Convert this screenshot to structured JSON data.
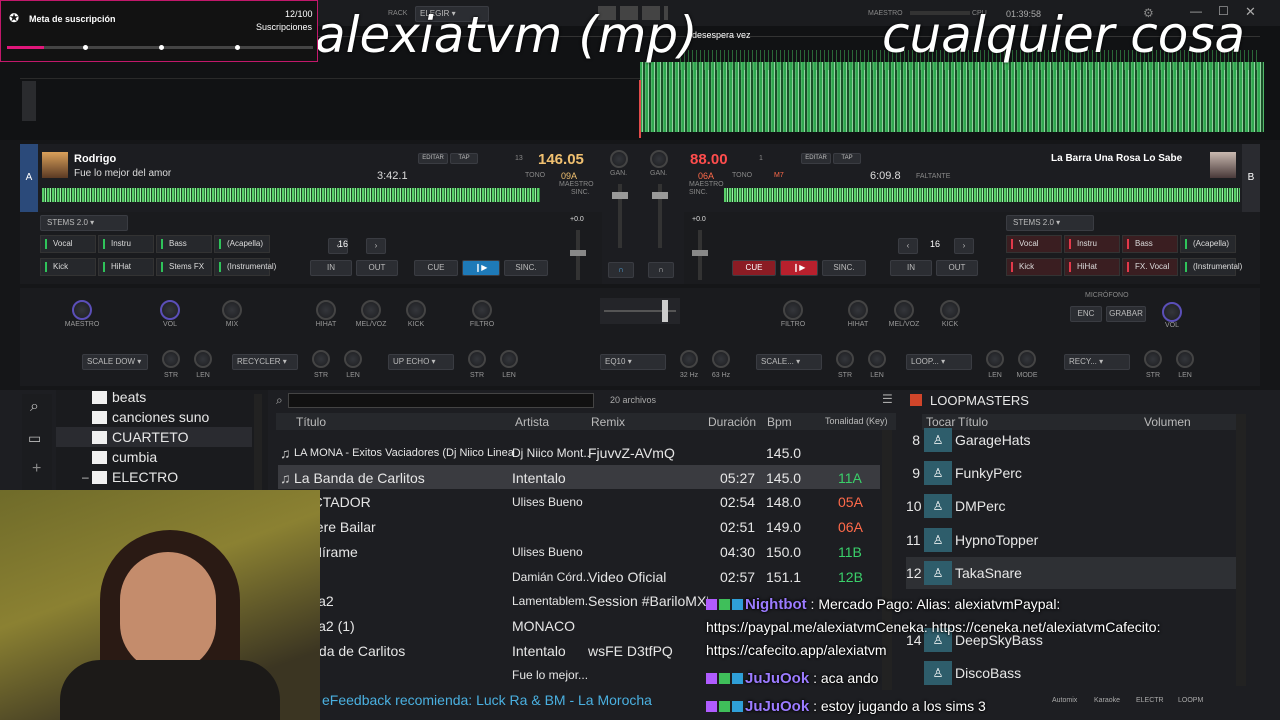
{
  "overlay": {
    "sub_goal_label": "Meta de suscripción",
    "sub_goal_count": "12/100",
    "sub_goal_unit": "Suscripciones",
    "sub_goal_progress": 0.12,
    "title_left": "alexiatvm (mp)",
    "title_right": "cualquier cosa"
  },
  "topbar": {
    "rack_label": "RACK",
    "rack_value": "ELEGIR",
    "master_label": "MAESTRO",
    "cpu_label": "CPU",
    "clock": "01:39:58",
    "overview_caption": "desespera vez"
  },
  "deck_a": {
    "letter": "A",
    "artist": "Rodrigo",
    "title": "Fue lo mejor del amor",
    "time": "3:42.1",
    "bpm": "146.05",
    "key": "09A",
    "key_num": "13",
    "pitch_label": "TONO",
    "edit_label": "EDITAR",
    "tap_label": "TAP",
    "master_label": "MAESTRO",
    "sync_label": "SINC.",
    "stems_label": "STEMS 2.0",
    "loop_value": "16",
    "stems": [
      "Vocal",
      "Instru",
      "Bass",
      "(Acapella)",
      "Kick",
      "HiHat",
      "Stems FX",
      "(Instrumental)"
    ],
    "in_label": "IN",
    "out_label": "OUT",
    "cue_label": "CUE",
    "sync_btn": "SINC.",
    "pitch_value": "+0.0",
    "pad_buttons": [
      "CT",
      "BLOODAT",
      "SLIP",
      "VINYL"
    ],
    "loop_vert": "LOOP",
    "pads_vert": "PADS",
    "gain_label": "GAN."
  },
  "deck_b": {
    "letter": "B",
    "artist": "",
    "title": "La Barra Una Rosa Lo Sabe",
    "time": "6:09.8",
    "time_label": "FALTANTE",
    "bpm": "88.00",
    "key": "06A",
    "key_num": "1",
    "key_b": "M7",
    "pitch_label": "TONO",
    "edit_label": "EDITAR",
    "tap_label": "TAP",
    "master_label": "MAESTRO",
    "sync_label": "SINC.",
    "stems_label": "STEMS 2.0",
    "loop_value": "16",
    "stems": [
      "Vocal",
      "Instru",
      "Bass",
      "(Acapella)",
      "Kick",
      "HiHat",
      "FX. Vocal",
      "(Instrumental)"
    ],
    "in_label": "IN",
    "out_label": "OUT",
    "cue_label": "CUE",
    "sync_btn": "SINC.",
    "pitch_value": "+0.0",
    "pad_buttons": [
      "VINYL",
      "SLIP",
      "BLOODAT",
      "CT"
    ],
    "gain_label": "GAN."
  },
  "fx": {
    "left_knobs": [
      "MAESTRO",
      "VOL",
      "MIX"
    ],
    "deck_a_eq": [
      "HIHAT",
      "MEL/VOZ",
      "KICK",
      "FILTRO"
    ],
    "deck_b_eq": [
      "FILTRO",
      "HIHAT",
      "MEL/VOZ",
      "KICK"
    ],
    "mic_label": "MICRÓFONO",
    "mic_buttons": [
      "ENC",
      "GRABAR"
    ],
    "mic_vol": "VOL",
    "side_labels": [
      "MAESTRO",
      "DECKA",
      "DECKB",
      "MIC",
      "MAESTRO",
      "DECKA",
      "DECKB"
    ],
    "row3": [
      {
        "select": "SCALE DOW",
        "knobs": [
          "STR",
          "LEN"
        ]
      },
      {
        "select": "RECYCLER",
        "knobs": [
          "STR",
          "LEN"
        ]
      },
      {
        "select": "UP ECHO",
        "knobs": [
          "STR",
          "LEN"
        ]
      },
      {
        "select": "EQ10",
        "knobs": [
          "32 Hz",
          "63 Hz"
        ]
      },
      {
        "select": "SCALE...",
        "knobs": [
          "STR",
          "LEN"
        ]
      },
      {
        "select": "LOOP...",
        "knobs": [
          "LEN",
          "MODE"
        ]
      },
      {
        "select": "RECY...",
        "knobs": [
          "STR",
          "LEN"
        ]
      }
    ]
  },
  "browser": {
    "folders": [
      "beats",
      "canciones suno",
      "CUARTETO",
      "cumbia",
      "ELECTRO"
    ],
    "files_count": "20 archivos",
    "search_placeholder": "",
    "columns": [
      "Título",
      "Artista",
      "Remix",
      "Duración",
      "Bpm",
      "Tonalidad (Key)"
    ],
    "rows": [
      {
        "title": "LA MONA - Exitos Vaciadores (Dj Niico Linea 49)",
        "artist": "Dj Niico Mont...",
        "remix": "FjuvvZ-AVmQ",
        "duration": "",
        "bpm": "145.0",
        "key": ""
      },
      {
        "title": "La Banda de Carlitos",
        "artist": "Intentalo",
        "remix": "",
        "duration": "05:27",
        "bpm": "145.0",
        "key": "11A"
      },
      {
        "title": "PECTADOR",
        "artist": "Ulises Bueno",
        "remix": "",
        "duration": "02:54",
        "bpm": "148.0",
        "key": "05A"
      },
      {
        "title": "Quiere Bailar",
        "artist": "",
        "remix": "",
        "duration": "02:51",
        "bpm": "149.0",
        "key": "06A"
      },
      {
        "title": "ra Mírame",
        "artist": "Ulises Bueno",
        "remix": "",
        "duration": "04:30",
        "bpm": "150.0",
        "key": "11B"
      },
      {
        "title": "Tal",
        "artist": "Damián Córd...",
        "remix": "Video Oficial",
        "duration": "02:57",
        "bpm": "151.1",
        "key": "12B"
      },
      {
        "title": "aKTa2",
        "artist": "Lamentablem...",
        "remix": "Session #BariloMXD",
        "duration": "",
        "bpm": "",
        "key": ""
      },
      {
        "title": "aKTa2 (1)",
        "artist": "MONACO",
        "remix": "",
        "duration": "",
        "bpm": "",
        "key": ""
      },
      {
        "title": "Banda de Carlitos",
        "artist": "Intentalo",
        "remix": "wsFE D3tfPQ",
        "duration": "",
        "bpm": "",
        "key": ""
      },
      {
        "title": "rigo",
        "artist": "Fue lo mejor...",
        "remix": "",
        "duration": "",
        "bpm": "",
        "key": ""
      }
    ],
    "feedback": "eFeedback recomienda: Luck Ra & BM - La Morocha"
  },
  "loopmasters": {
    "title": "LOOPMASTERS",
    "columns": [
      "Tocar",
      "Título",
      "Volumen"
    ],
    "items": [
      {
        "num": "8",
        "name": "GarageHats"
      },
      {
        "num": "9",
        "name": "FunkyPerc"
      },
      {
        "num": "10",
        "name": "DMPerc"
      },
      {
        "num": "11",
        "name": "HypnoTopper"
      },
      {
        "num": "12",
        "name": "TakaSnare"
      },
      {
        "num": "14",
        "name": "DeepSkyBass"
      },
      {
        "num": "",
        "name": "DiscoBass"
      }
    ],
    "bottom_tabs": [
      "Automix",
      "Karaoke",
      "ELECTR",
      "LOOPM"
    ]
  },
  "chat": [
    {
      "user": "Nightbot",
      "text": "Mercado Pago: Alias: alexiatvmPaypal:"
    },
    {
      "user": "",
      "text": "https://paypal.me/alexiatvmCeneka: https://ceneka.net/alexiatvmCafecito:"
    },
    {
      "user": "",
      "text": "https://cafecito.app/alexiatvm"
    },
    {
      "user": "JuJuOok",
      "text": "aca ando"
    },
    {
      "user": "JuJuOok",
      "text": "estoy jugando a los sims 3"
    }
  ],
  "colors": {
    "accent_green": "#2fc35a",
    "accent_red": "#e3394a",
    "bpm_a": "#f0c070",
    "bpm_b": "#ff4d4d",
    "chat_user": "#9b7bff",
    "key_green": "#3ad06a",
    "key_red": "#ff6a4a",
    "sub_goal": "#e0177a"
  }
}
